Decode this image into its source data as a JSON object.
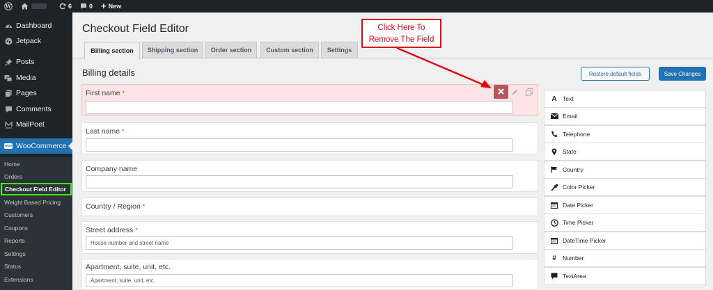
{
  "adminbar": {
    "updates_count": "6",
    "comments_count": "0",
    "new_label": "New"
  },
  "sidebar": {
    "menu": [
      {
        "label": "Dashboard",
        "icon": "dashboard-icon"
      },
      {
        "label": "Jetpack",
        "icon": "jetpack-icon"
      },
      {
        "label": "Posts",
        "icon": "pin-icon"
      },
      {
        "label": "Media",
        "icon": "media-icon"
      },
      {
        "label": "Pages",
        "icon": "pages-icon"
      },
      {
        "label": "Comments",
        "icon": "comment-icon"
      },
      {
        "label": "MailPoet",
        "icon": "mailpoet-icon"
      }
    ],
    "woocommerce_label": "WooCommerce",
    "woo_badge": "woo",
    "submenu": [
      "Home",
      "Orders",
      "Checkout Field Editor",
      "Weight Based Pricing",
      "Customers",
      "Coupons",
      "Reports",
      "Settings",
      "Status",
      "Extensions"
    ]
  },
  "main": {
    "title": "Checkout Field Editor",
    "tabs": [
      "Billing section",
      "Shipping section",
      "Order section",
      "Custom section",
      "Settings"
    ],
    "section_heading": "Billing details",
    "restore_button": "Restore default fields",
    "save_button": "Save Changes",
    "required_mark": "*",
    "fields": [
      {
        "label": "First name",
        "required": true,
        "placeholder": ""
      },
      {
        "label": "Last name",
        "required": true,
        "placeholder": ""
      },
      {
        "label": "Company name",
        "required": false,
        "placeholder": ""
      },
      {
        "label": "Country / Region",
        "required": true,
        "placeholder": ""
      },
      {
        "label": "Street address",
        "required": true,
        "placeholder": "House number and street name"
      },
      {
        "label": "Apartment, suite, unit, etc.",
        "required": false,
        "placeholder": "Apartment, suite, unit, etc."
      }
    ]
  },
  "callout": {
    "line1": "Click Here To",
    "line2": "Remove The Field",
    "color": "#e30613"
  },
  "field_types": [
    {
      "label": "Text",
      "icon": "text-icon"
    },
    {
      "label": "Email",
      "icon": "email-icon"
    },
    {
      "label": "Telephone",
      "icon": "phone-icon"
    },
    {
      "label": "State",
      "icon": "location-pin-icon"
    },
    {
      "label": "Country",
      "icon": "flag-icon"
    },
    {
      "label": "Color Picker",
      "icon": "eyedropper-icon"
    },
    {
      "label": "Date Picker",
      "icon": "calendar-icon"
    },
    {
      "label": "Time Picker",
      "icon": "clock-icon"
    },
    {
      "label": "DateTime Picker",
      "icon": "calendar-icon"
    },
    {
      "label": "Number",
      "icon": "hash-icon"
    },
    {
      "label": "TextArea",
      "icon": "speech-bubble-icon"
    }
  ],
  "colors": {
    "admin_dark": "#1d2327",
    "accent_blue": "#2271b1",
    "highlight_green": "#39ff14",
    "remove_red": "#b4565c",
    "highlight_row": "#fce4e4"
  }
}
